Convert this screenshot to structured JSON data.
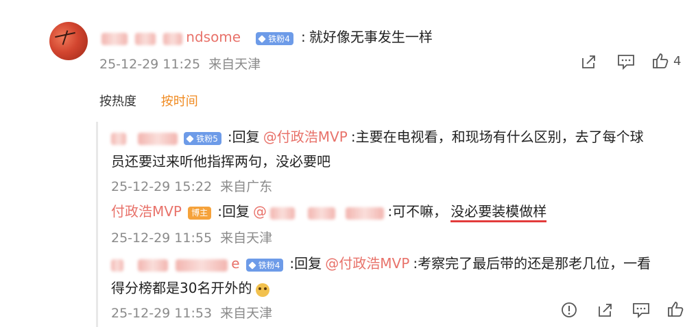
{
  "main_comment": {
    "username": "ndsome",
    "fan_badge": "铁粉4",
    "separator": ":",
    "text": "就好像无事发生一样",
    "timestamp": "25-12-29 11:25",
    "location": "来自天津",
    "like_count": "4"
  },
  "sort": {
    "hot_label": "按热度",
    "time_label": "按时间",
    "active": "按时间"
  },
  "replies": [
    {
      "fan_badge": "铁粉5",
      "reply_prefix": ":回复",
      "mention": "@付政浩MVP",
      "text_line1": ":主要在电视看，和现场有什么区别，去了每个球",
      "text_line2": "员还要过来听他指挥两句，没必要吧",
      "timestamp": "25-12-29 15:22",
      "location": "来自广东"
    },
    {
      "username": "付政浩MVP",
      "host_badge": "博主",
      "reply_prefix": ":回复",
      "mention_at": "@",
      "text_plain": ":可不嘛，",
      "text_underlined": "没必要装模做样",
      "timestamp": "25-12-29 11:55",
      "location": "来自天津"
    },
    {
      "username_tail": "e",
      "fan_badge": "铁粉4",
      "reply_prefix": ":回复",
      "mention": "@付政浩MVP",
      "text_line1": ":考察完了最后带的还是那老几位，一看",
      "text_line2": "得分榜都是30名开外的",
      "timestamp": "25-12-29 11:53",
      "location": "来自天津"
    }
  ],
  "icons": {
    "share": "share-icon",
    "comment": "comment-icon",
    "like": "thumb-up-icon",
    "report": "report-icon",
    "emoji": "doge-emoji-icon"
  },
  "colors": {
    "username_pink": "#e8726a",
    "fan_badge_blue": "#6d9be8",
    "host_badge_orange": "#f5a23b",
    "sort_active_orange": "#f08a20",
    "meta_gray": "#8a8a8a",
    "underline_red": "#e23b3b"
  }
}
